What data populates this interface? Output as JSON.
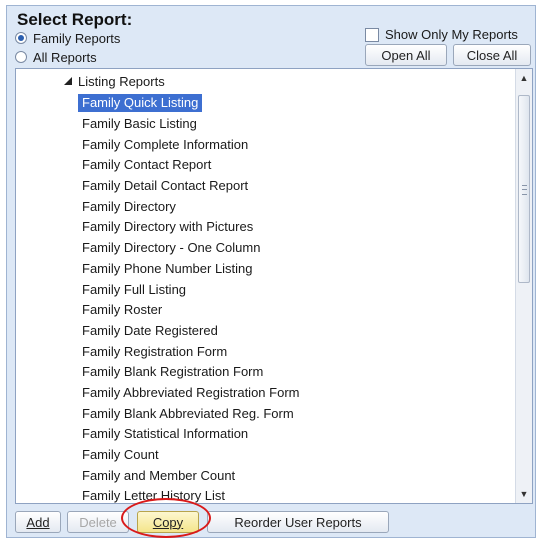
{
  "header": {
    "title": "Select Report:"
  },
  "report_scope": {
    "options": [
      {
        "label": "Family Reports",
        "selected": true
      },
      {
        "label": "All Reports",
        "selected": false
      }
    ]
  },
  "filters": {
    "show_only_mine_label": "Show Only My Reports",
    "show_only_mine_checked": false
  },
  "tree_controls": {
    "open_all_label": "Open All",
    "close_all_label": "Close All"
  },
  "report_tree": {
    "root_label": "Listing Reports",
    "items": [
      "Family Quick Listing",
      "Family Basic Listing",
      "Family Complete Information",
      "Family Contact Report",
      "Family Detail Contact Report",
      "Family Directory",
      "Family Directory with Pictures",
      "Family Directory - One Column",
      "Family Phone Number Listing",
      "Family Full Listing",
      "Family Roster",
      "Family Date Registered",
      "Family Registration Form",
      "Family Blank Registration Form",
      "Family Abbreviated Registration Form",
      "Family Blank Abbreviated Reg. Form",
      "Family Statistical Information",
      "Family Count",
      "Family and Member Count",
      "Family Letter History List"
    ],
    "selected_index": 0
  },
  "actions": {
    "add_label": "Add",
    "delete_label": "Delete",
    "copy_label": "Copy",
    "reorder_label": "Reorder User Reports"
  },
  "colors": {
    "panel_bg": "#dde8f6",
    "selection": "#3d6fd1",
    "highlight_circle": "#d91a1a",
    "copy_button": "#f4e58b"
  }
}
